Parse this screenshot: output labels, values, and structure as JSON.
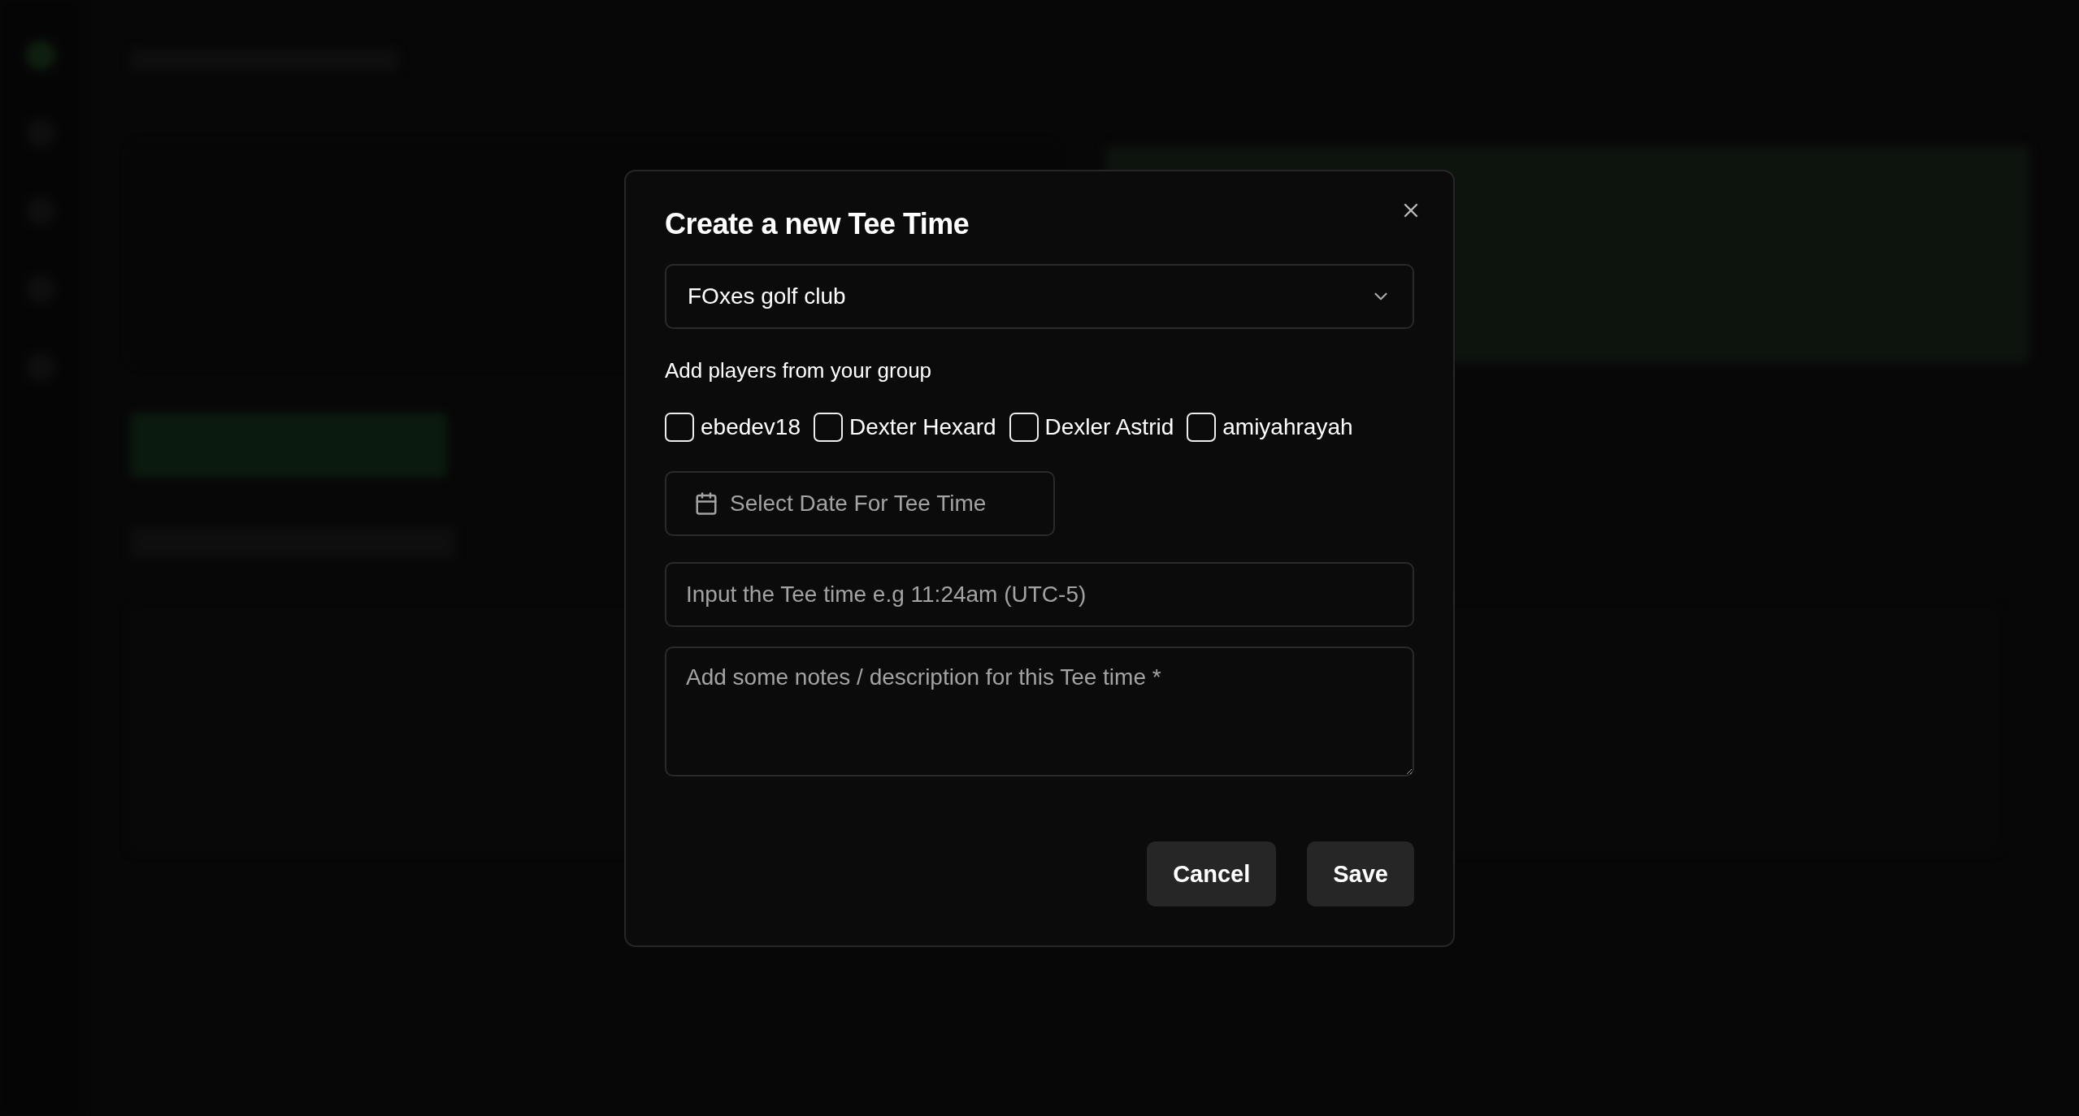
{
  "dialog": {
    "title": "Create a new Tee Time",
    "club_select": {
      "value": "FOxes golf club"
    },
    "players_label": "Add players from your group",
    "players": [
      {
        "name": "ebedev18",
        "checked": false
      },
      {
        "name": "Dexter Hexard",
        "checked": false
      },
      {
        "name": "Dexler Astrid",
        "checked": false
      },
      {
        "name": "amiyahrayah",
        "checked": false
      }
    ],
    "date_picker": {
      "placeholder": "Select Date For Tee Time"
    },
    "time_field": {
      "placeholder": "Input the Tee time e.g 11:24am (UTC-5)"
    },
    "notes_field": {
      "placeholder": "Add some notes / description for this Tee time *"
    },
    "buttons": [
      "Cancel",
      "Save"
    ]
  }
}
